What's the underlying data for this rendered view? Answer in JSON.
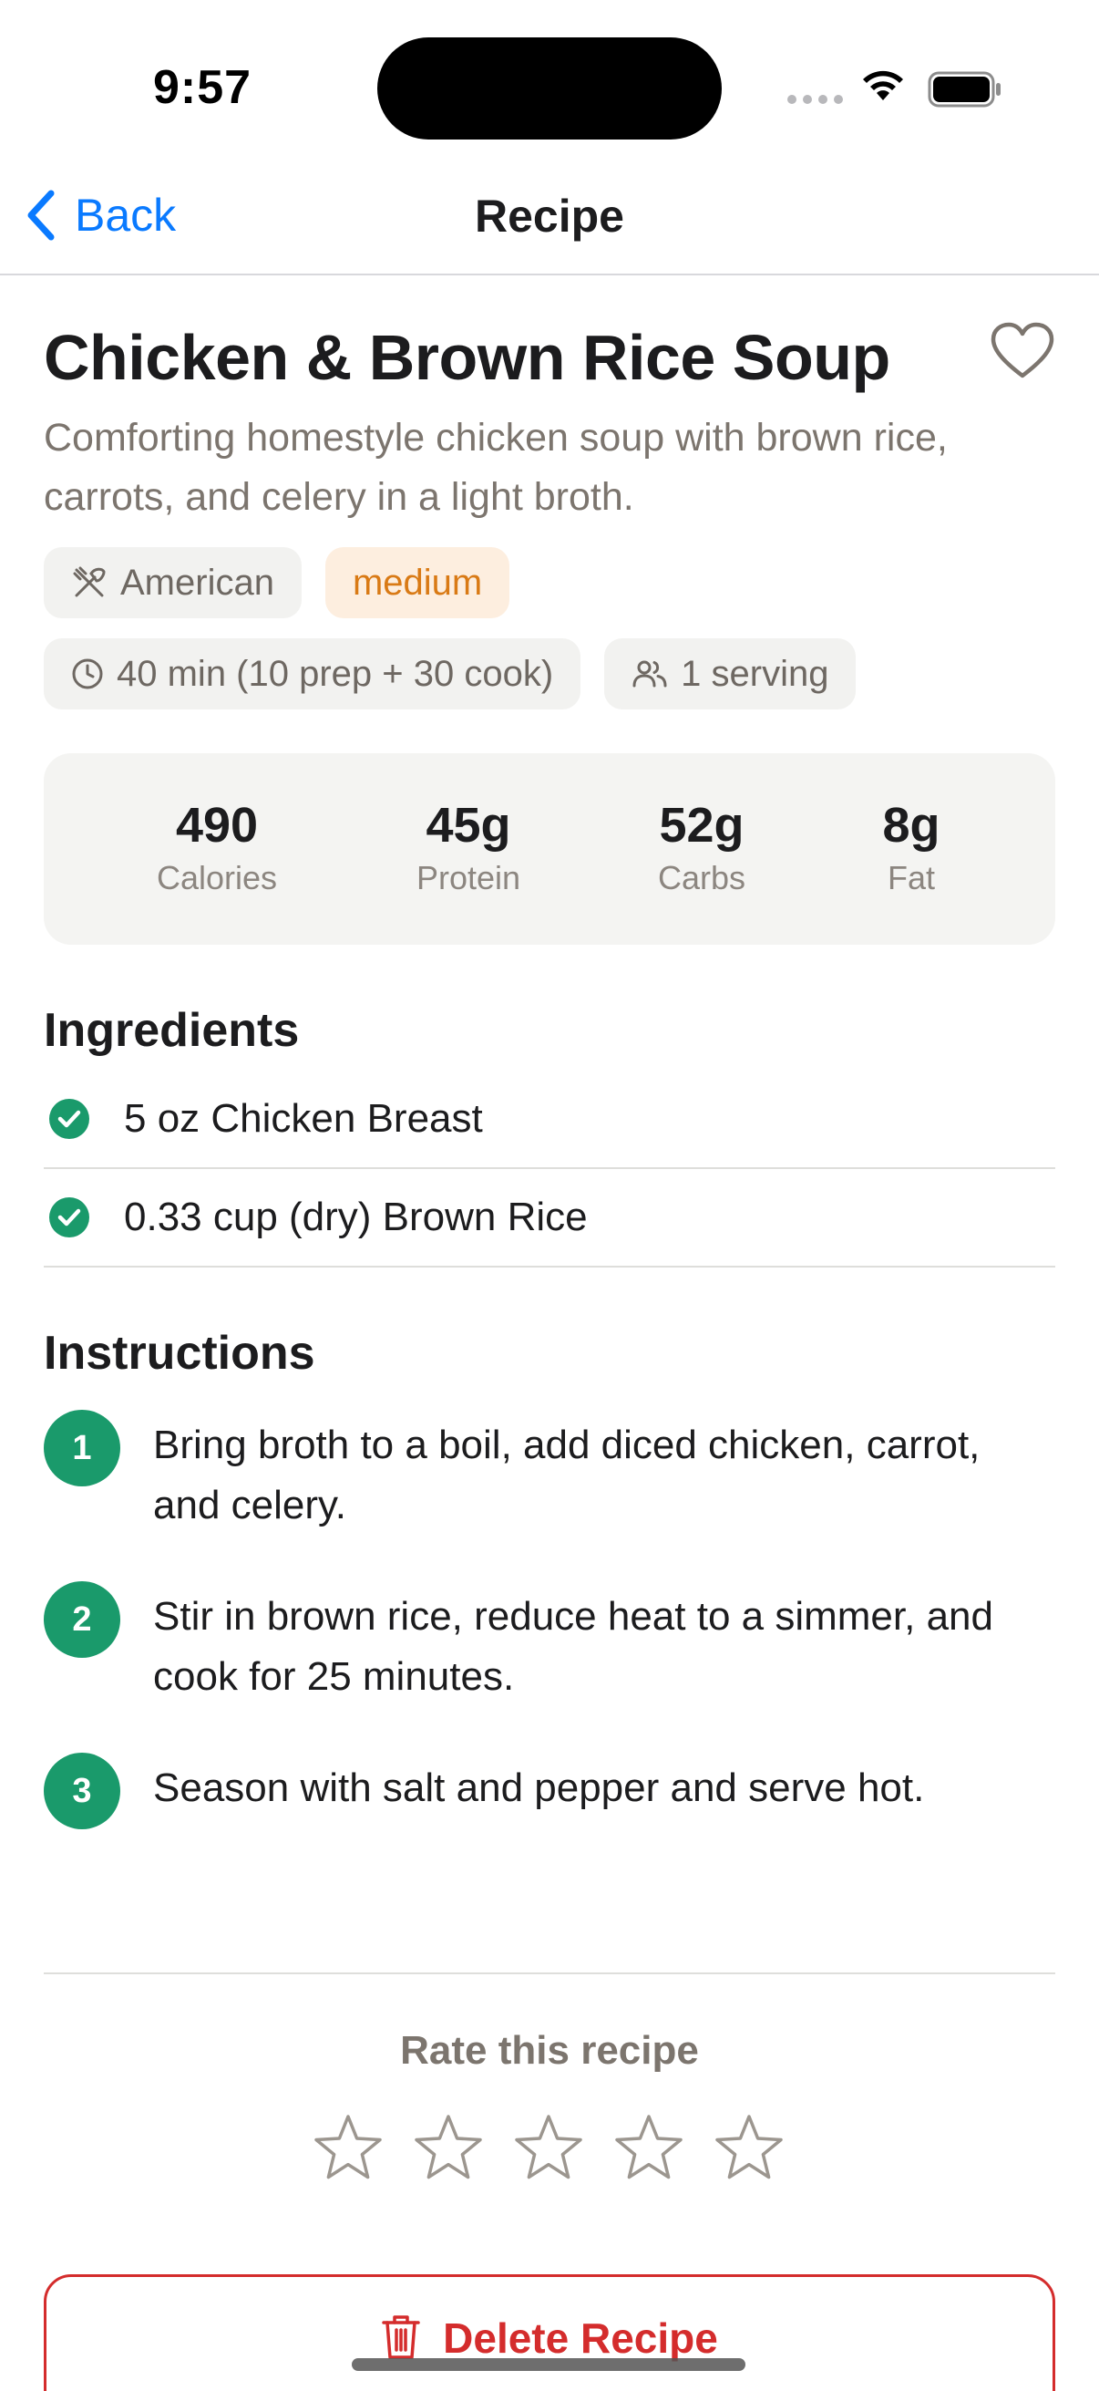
{
  "status_bar": {
    "time": "9:57"
  },
  "nav": {
    "back_label": "Back",
    "title": "Recipe"
  },
  "recipe": {
    "title": "Chicken & Brown Rice Soup",
    "favorited": false,
    "description": "Comforting homestyle chicken soup with brown rice, carrots, and celery in a light broth.",
    "cuisine": "American",
    "difficulty": "medium",
    "time": "40 min (10 prep + 30 cook)",
    "servings": "1 serving"
  },
  "nutrition": [
    {
      "value": "490",
      "label": "Calories"
    },
    {
      "value": "45g",
      "label": "Protein"
    },
    {
      "value": "52g",
      "label": "Carbs"
    },
    {
      "value": "8g",
      "label": "Fat"
    }
  ],
  "ingredients": {
    "title": "Ingredients",
    "items": [
      {
        "text": "5 oz Chicken Breast",
        "checked": true
      },
      {
        "text": "0.33 cup (dry) Brown Rice",
        "checked": true
      }
    ]
  },
  "instructions": {
    "title": "Instructions",
    "steps": [
      {
        "number": "1",
        "text": "Bring broth to a boil, add diced chicken, carrot, and celery."
      },
      {
        "number": "2",
        "text": "Stir in brown rice, reduce heat to a simmer, and cook for 25 minutes."
      },
      {
        "number": "3",
        "text": "Season with salt and pepper and serve hot."
      }
    ]
  },
  "rating": {
    "title": "Rate this recipe",
    "value": 0,
    "max": 5
  },
  "delete": {
    "label": "Delete Recipe"
  },
  "colors": {
    "accent_blue": "#0a7aff",
    "step_green": "#1a9a6b",
    "difficulty_orange": "#d97a15",
    "delete_red": "#d42c2c"
  },
  "icons": {
    "back": "chevron-left-icon",
    "favorite": "heart-outline-icon",
    "cuisine": "utensils-crossed-icon",
    "time": "clock-icon",
    "servings": "users-icon",
    "ingredient": "check-circle-icon",
    "star": "star-outline-icon",
    "delete": "trash-icon"
  }
}
